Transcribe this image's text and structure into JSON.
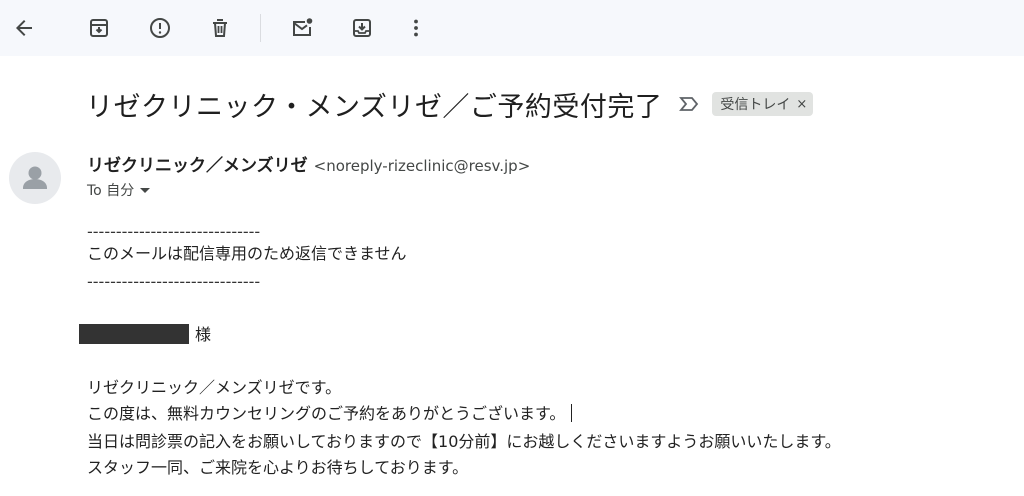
{
  "toolbar": {
    "buttons": [
      {
        "icon": "back-arrow-icon"
      },
      {
        "icon": "archive-icon"
      },
      {
        "icon": "report-spam-icon"
      },
      {
        "icon": "delete-icon"
      },
      {
        "icon": "mark-unread-icon"
      },
      {
        "icon": "move-to-icon"
      },
      {
        "icon": "more-vert-icon"
      }
    ]
  },
  "email": {
    "subject": "リゼクリニック・メンズリゼ／ご予約受付完了",
    "label": "受信トレイ",
    "label_remove": "×",
    "sender_name": "リゼクリニック／メンズリゼ",
    "sender_email": "<noreply-rizeclinic@resv.jp>",
    "to": "To 自分",
    "body": {
      "dash_top": "------------------------------",
      "notice": "このメールは配信専用のため返信できません",
      "dash_bottom": "------------------------------",
      "salutation": "様",
      "line1": "リゼクリニック／メンズリゼです。",
      "line2": "この度は、無料カウンセリングのご予約をありがとうございます。",
      "line3": "当日は問診票の記入をお願いしておりますので【10分前】にお越しくださいますようお願いいたします。",
      "line4": "スタッフ一同、ご来院を心よりお待ちしております。"
    }
  },
  "colors": {
    "toolbar_bg": "#f6f8fc",
    "icon": "#444746",
    "chip_bg": "#e1e3e1"
  }
}
